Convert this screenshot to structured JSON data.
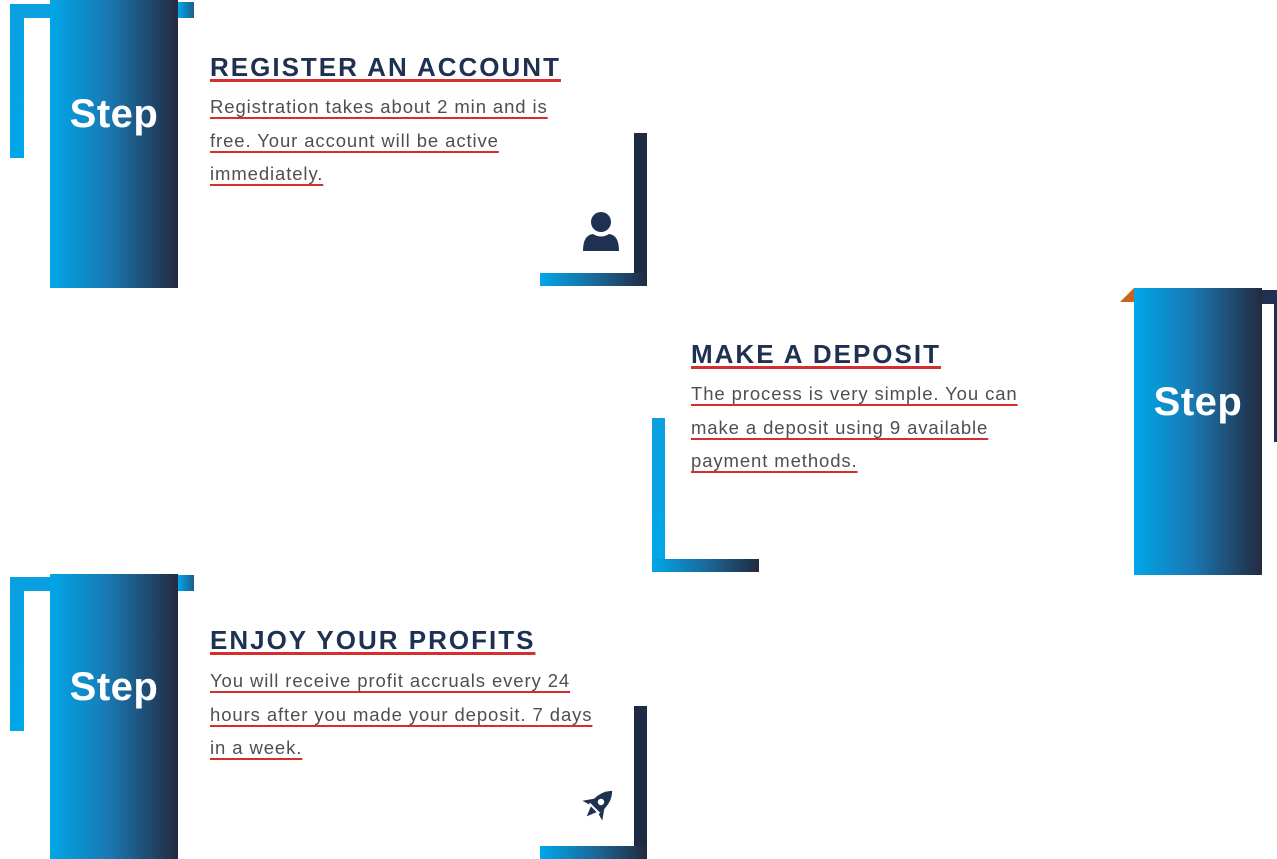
{
  "steps": [
    {
      "tab_label": "Step",
      "title": "REGISTER AN ACCOUNT",
      "description": "Registration takes about 2 min and is free. Your account will be active immediately.",
      "icon": "user-icon"
    },
    {
      "tab_label": "Step",
      "title": "MAKE A DEPOSIT",
      "description": "The process is very simple. You can make a deposit using 9 available payment methods.",
      "icon": "none"
    },
    {
      "tab_label": "Step",
      "title": "ENJOY YOUR PROFITS",
      "description": "You will receive profit accruals every 24 hours after you made your deposit. 7 days in a week.",
      "icon": "rocket-icon"
    }
  ],
  "colors": {
    "accent_blue": "#00a7e8",
    "navy": "#1f3151",
    "underline_red": "#d42e2e",
    "corner_orange": "#c8651b",
    "text_gray": "#4f4f4f"
  }
}
